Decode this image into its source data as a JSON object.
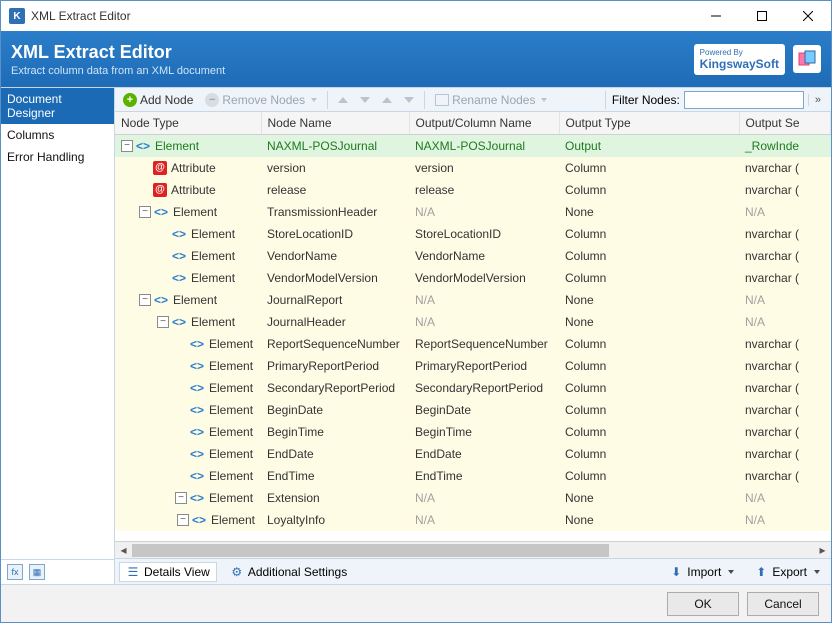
{
  "titlebar": {
    "title": "XML Extract Editor"
  },
  "header": {
    "title": "XML Extract Editor",
    "subtitle": "Extract column data from an XML document",
    "poweredBy": "Powered By",
    "brand": "KingswaySoft"
  },
  "sidebar": {
    "items": [
      {
        "label": "Document Designer",
        "active": true
      },
      {
        "label": "Columns",
        "active": false
      },
      {
        "label": "Error Handling",
        "active": false
      }
    ]
  },
  "toolbar": {
    "addNode": "Add Node",
    "removeNodes": "Remove Nodes",
    "renameNodes": "Rename Nodes",
    "filterLabel": "Filter Nodes:"
  },
  "columns": {
    "nodeType": "Node Type",
    "nodeName": "Node Name",
    "outputColumn": "Output/Column Name",
    "outputType": "Output Type",
    "outputSettings": "Output Se"
  },
  "rows": [
    {
      "depth": 0,
      "exp": "-",
      "icon": "el",
      "nodeType": "Element",
      "nodeName": "NAXML-POSJournal",
      "outCol": "NAXML-POSJournal",
      "outType": "Output",
      "outSet": "_RowInde",
      "cls": "output"
    },
    {
      "depth": 1,
      "exp": "",
      "icon": "at",
      "nodeType": "Attribute",
      "nodeName": "version",
      "outCol": "version",
      "outType": "Column",
      "outSet": "nvarchar (",
      "cls": "attr"
    },
    {
      "depth": 1,
      "exp": "",
      "icon": "at",
      "nodeType": "Attribute",
      "nodeName": "release",
      "outCol": "release",
      "outType": "Column",
      "outSet": "nvarchar (",
      "cls": "attr"
    },
    {
      "depth": 1,
      "exp": "-",
      "icon": "el",
      "nodeType": "Element",
      "nodeName": "TransmissionHeader",
      "outCol": "N/A",
      "outType": "None",
      "outSet": "N/A",
      "cls": "none"
    },
    {
      "depth": 2,
      "exp": "",
      "icon": "el",
      "nodeType": "Element",
      "nodeName": "StoreLocationID",
      "outCol": "StoreLocationID",
      "outType": "Column",
      "outSet": "nvarchar (",
      "cls": "elem"
    },
    {
      "depth": 2,
      "exp": "",
      "icon": "el",
      "nodeType": "Element",
      "nodeName": "VendorName",
      "outCol": "VendorName",
      "outType": "Column",
      "outSet": "nvarchar (",
      "cls": "elem"
    },
    {
      "depth": 2,
      "exp": "",
      "icon": "el",
      "nodeType": "Element",
      "nodeName": "VendorModelVersion",
      "outCol": "VendorModelVersion",
      "outType": "Column",
      "outSet": "nvarchar (",
      "cls": "elem"
    },
    {
      "depth": 1,
      "exp": "-",
      "icon": "el",
      "nodeType": "Element",
      "nodeName": "JournalReport",
      "outCol": "N/A",
      "outType": "None",
      "outSet": "N/A",
      "cls": "none"
    },
    {
      "depth": 2,
      "exp": "-",
      "icon": "el",
      "nodeType": "Element",
      "nodeName": "JournalHeader",
      "outCol": "N/A",
      "outType": "None",
      "outSet": "N/A",
      "cls": "none"
    },
    {
      "depth": 3,
      "exp": "",
      "icon": "el",
      "nodeType": "Element",
      "nodeName": "ReportSequenceNumber",
      "outCol": "ReportSequenceNumber",
      "outType": "Column",
      "outSet": "nvarchar (",
      "cls": "elem"
    },
    {
      "depth": 3,
      "exp": "",
      "icon": "el",
      "nodeType": "Element",
      "nodeName": "PrimaryReportPeriod",
      "outCol": "PrimaryReportPeriod",
      "outType": "Column",
      "outSet": "nvarchar (",
      "cls": "elem"
    },
    {
      "depth": 3,
      "exp": "",
      "icon": "el",
      "nodeType": "Element",
      "nodeName": "SecondaryReportPeriod",
      "outCol": "SecondaryReportPeriod",
      "outType": "Column",
      "outSet": "nvarchar (",
      "cls": "elem"
    },
    {
      "depth": 3,
      "exp": "",
      "icon": "el",
      "nodeType": "Element",
      "nodeName": "BeginDate",
      "outCol": "BeginDate",
      "outType": "Column",
      "outSet": "nvarchar (",
      "cls": "elem"
    },
    {
      "depth": 3,
      "exp": "",
      "icon": "el",
      "nodeType": "Element",
      "nodeName": "BeginTime",
      "outCol": "BeginTime",
      "outType": "Column",
      "outSet": "nvarchar (",
      "cls": "elem"
    },
    {
      "depth": 3,
      "exp": "",
      "icon": "el",
      "nodeType": "Element",
      "nodeName": "EndDate",
      "outCol": "EndDate",
      "outType": "Column",
      "outSet": "nvarchar (",
      "cls": "elem"
    },
    {
      "depth": 3,
      "exp": "",
      "icon": "el",
      "nodeType": "Element",
      "nodeName": "EndTime",
      "outCol": "EndTime",
      "outType": "Column",
      "outSet": "nvarchar (",
      "cls": "elem"
    },
    {
      "depth": 3,
      "exp": "-",
      "icon": "el",
      "nodeType": "Element",
      "nodeName": "Extension",
      "outCol": "N/A",
      "outType": "None",
      "outSet": "N/A",
      "cls": "none"
    },
    {
      "depth": 4,
      "exp": "-",
      "icon": "el",
      "nodeType": "Element",
      "nodeName": "LoyaltyInfo",
      "outCol": "N/A",
      "outType": "None",
      "outSet": "N/A",
      "cls": "none"
    }
  ],
  "bottomTabs": {
    "details": "Details View",
    "additional": "Additional Settings",
    "import": "Import",
    "export": "Export"
  },
  "footer": {
    "ok": "OK",
    "cancel": "Cancel"
  }
}
